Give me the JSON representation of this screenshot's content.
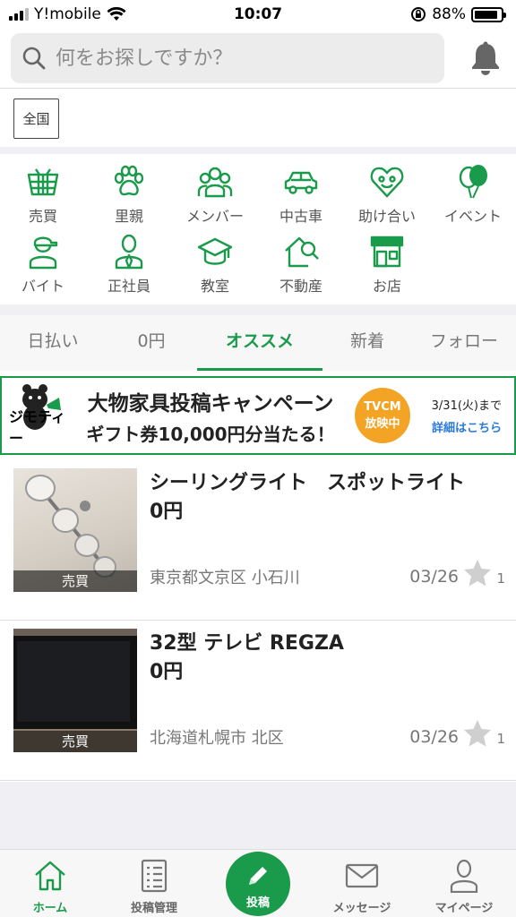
{
  "status_bar": {
    "carrier": "Y!mobile",
    "time": "10:07",
    "battery_percent": "88%",
    "battery_level": 0.88
  },
  "search": {
    "placeholder": "何をお探しですか？"
  },
  "region_button": "全国",
  "categories": [
    {
      "label": "売買",
      "icon": "basket-icon"
    },
    {
      "label": "里親",
      "icon": "paw-icon"
    },
    {
      "label": "メンバー",
      "icon": "members-icon"
    },
    {
      "label": "中古車",
      "icon": "car-icon"
    },
    {
      "label": "助け合い",
      "icon": "heart-face-icon"
    },
    {
      "label": "イベント",
      "icon": "balloon-icon"
    },
    {
      "label": "バイト",
      "icon": "parttime-worker-icon"
    },
    {
      "label": "正社員",
      "icon": "employee-icon"
    },
    {
      "label": "教室",
      "icon": "mortarboard-icon"
    },
    {
      "label": "不動産",
      "icon": "house-search-icon"
    },
    {
      "label": "お店",
      "icon": "shop-icon"
    }
  ],
  "tabs": [
    {
      "label": "日払い",
      "active": false
    },
    {
      "label": "0円",
      "active": false
    },
    {
      "label": "オススメ",
      "active": true
    },
    {
      "label": "新着",
      "active": false
    },
    {
      "label": "フォロー",
      "active": false
    }
  ],
  "banner": {
    "brand": "ジモティー",
    "headline": "大物家具投稿キャンペーン",
    "subline": "ギフト券10,000円分当たる！",
    "badge_line1": "TVCM",
    "badge_line2": "放映中",
    "date_text": "3/31(火)まで",
    "link_text": "詳細はこちら"
  },
  "listings": [
    {
      "title": "シーリングライト　スポットライト",
      "price": "0円",
      "tag": "売買",
      "location": "東京都文京区 小石川",
      "date": "03/26",
      "favorites": "1"
    },
    {
      "title": "32型 テレビ REGZA",
      "price": "0円",
      "tag": "売買",
      "location": "北海道札幌市 北区",
      "date": "03/26",
      "favorites": "1"
    }
  ],
  "bottom_nav": {
    "home": "ホーム",
    "posts": "投稿管理",
    "post": "投稿",
    "messages": "メッセージ",
    "mypage": "マイページ"
  },
  "colors": {
    "accent": "#1a9a4b",
    "badge": "#f3a425",
    "link": "#2a7ad8"
  }
}
